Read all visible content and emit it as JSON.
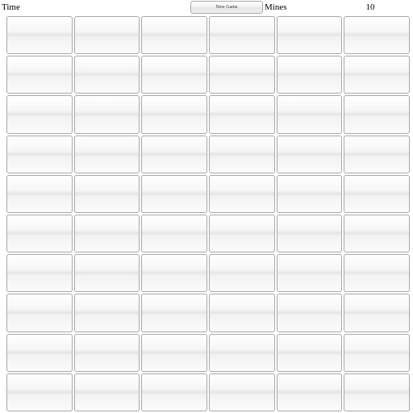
{
  "header": {
    "time_label": "Time",
    "time_value": "",
    "new_game_label": "New Game",
    "mines_label": "Mines",
    "mines_value": "10"
  },
  "grid": {
    "rows": 10,
    "cols": 6,
    "total_cells": 60,
    "mines": 10
  }
}
